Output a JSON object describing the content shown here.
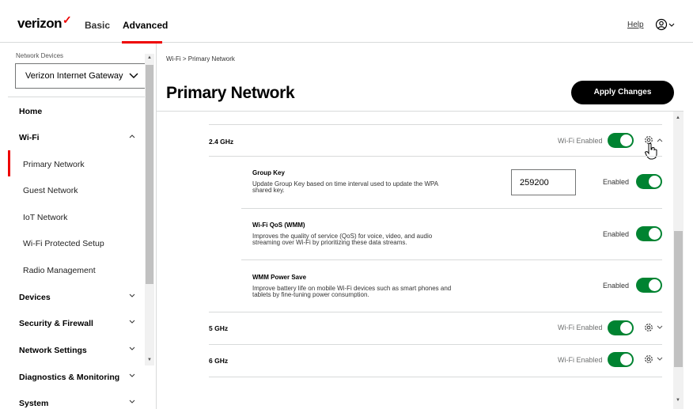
{
  "header": {
    "logo": "verizon",
    "logo_check": "✓",
    "tab_basic": "Basic",
    "tab_advanced": "Advanced",
    "help": "Help",
    "user_icon": "user-circle-icon"
  },
  "sidebar": {
    "device_label": "Network Devices",
    "device_select_value": "Verizon Internet Gateway",
    "items": [
      {
        "label": "Home"
      },
      {
        "label": "Wi-Fi"
      },
      {
        "label": "Primary Network"
      },
      {
        "label": "Guest Network"
      },
      {
        "label": "IoT Network"
      },
      {
        "label": "Wi-Fi Protected Setup"
      },
      {
        "label": "Radio Management"
      },
      {
        "label": "Devices"
      },
      {
        "label": "Security & Firewall"
      },
      {
        "label": "Network Settings"
      },
      {
        "label": "Diagnostics & Monitoring"
      },
      {
        "label": "System"
      }
    ]
  },
  "main": {
    "breadcrumb": "Wi-Fi  >  Primary Network",
    "title": "Primary Network",
    "apply_button": "Apply Changes",
    "bands": [
      {
        "name": "2.4 GHz",
        "status": "Wi-Fi Enabled",
        "enabled": true,
        "expanded": true
      },
      {
        "name": "5 GHz",
        "status": "Wi-Fi Enabled",
        "enabled": true,
        "expanded": false
      },
      {
        "name": "6 GHz",
        "status": "Wi-Fi Enabled",
        "enabled": true,
        "expanded": false
      }
    ],
    "settings": {
      "group_key": {
        "title": "Group Key",
        "desc1": "Update Group Key based on time interval used to update the WPA",
        "desc2": "shared key.",
        "value": "259200",
        "status": "Enabled",
        "enabled": true
      },
      "wmm": {
        "title": "Wi-Fi QoS (WMM)",
        "desc1": "Improves the quality of service (QoS) for voice, video, and audio",
        "desc2": "streaming over Wi-Fi by prioritizing these data streams.",
        "status": "Enabled",
        "enabled": true
      },
      "wmm_power": {
        "title": "WMM Power Save",
        "desc1": "Improve battery life on mobile Wi-Fi devices such as smart phones and",
        "desc2": "tablets by fine-tuning power consumption.",
        "status": "Enabled",
        "enabled": true
      }
    }
  },
  "colors": {
    "accent_red": "#ee0000",
    "toggle_green": "#008331",
    "button_black": "#000000"
  }
}
